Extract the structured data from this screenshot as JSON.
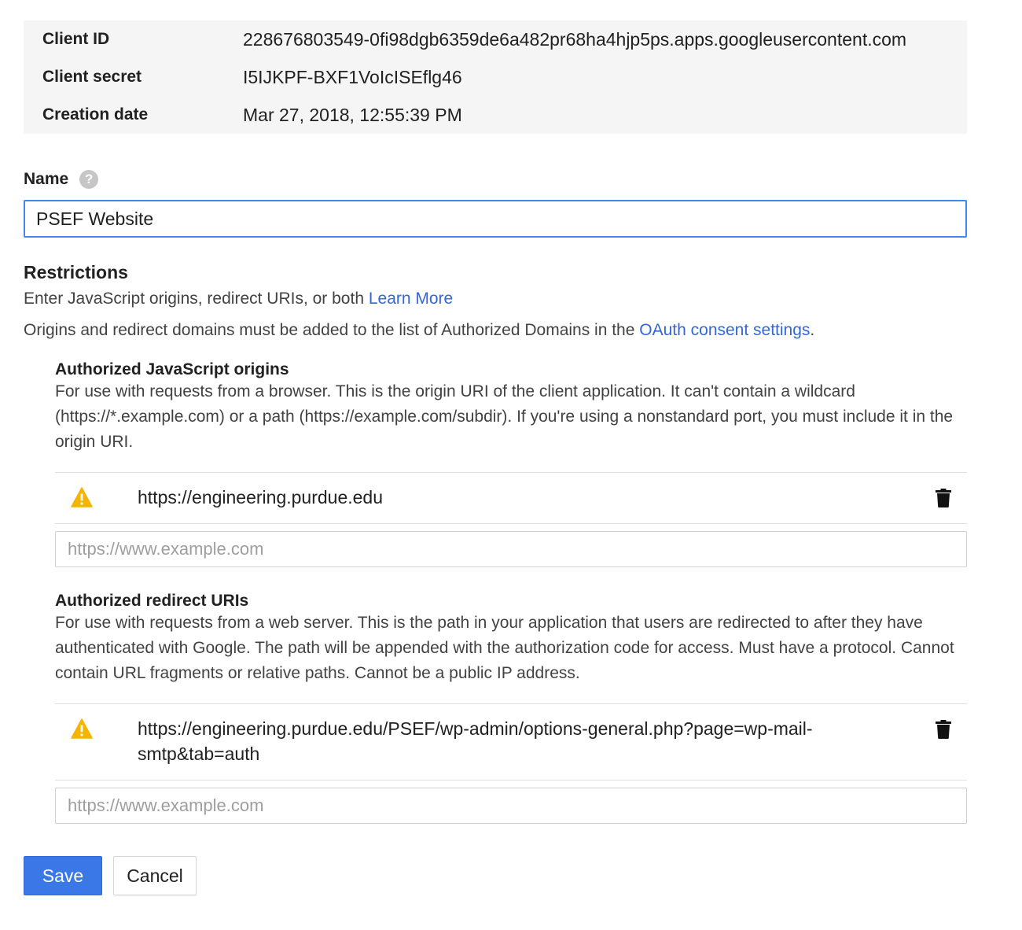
{
  "info": {
    "rows": [
      {
        "label": "Client ID",
        "value": "228676803549-0fi98dgb6359de6a482pr68ha4hjp5ps.apps.googleusercontent.com"
      },
      {
        "label": "Client secret",
        "value": "I5IJKPF-BXF1VoIcISEflg46"
      },
      {
        "label": "Creation date",
        "value": "Mar 27, 2018, 12:55:39 PM"
      }
    ]
  },
  "name": {
    "label": "Name",
    "help_icon": "help-circle-icon",
    "value": "PSEF Website"
  },
  "restrictions": {
    "title": "Restrictions",
    "intro_text": "Enter JavaScript origins, redirect URIs, or both ",
    "learn_more": "Learn More",
    "domains_text": "Origins and redirect domains must be added to the list of Authorized Domains in the ",
    "oauth_link": "OAuth consent settings",
    "domains_suffix": "."
  },
  "js_origins": {
    "title": "Authorized JavaScript origins",
    "description": "For use with requests from a browser. This is the origin URI of the client application. It can't contain a wildcard (https://*.example.com) or a path (https://example.com/subdir). If you're using a nonstandard port, you must include it in the origin URI.",
    "entries": [
      "https://engineering.purdue.edu"
    ],
    "placeholder": "https://www.example.com"
  },
  "redirect_uris": {
    "title": "Authorized redirect URIs",
    "description": "For use with requests from a web server. This is the path in your application that users are redirected to after they have authenticated with Google. The path will be appended with the authorization code for access. Must have a protocol. Cannot contain URL fragments or relative paths. Cannot be a public IP address.",
    "entries": [
      "https://engineering.purdue.edu/PSEF/wp-admin/options-general.php?page=wp-mail-smtp&tab=auth"
    ],
    "placeholder": "https://www.example.com"
  },
  "actions": {
    "save_label": "Save",
    "cancel_label": "Cancel"
  },
  "colors": {
    "accent": "#4285f4",
    "link": "#3367d6",
    "save_button": "#3b78e7",
    "warning": "#f4b400",
    "info_background": "#f5f5f5"
  }
}
